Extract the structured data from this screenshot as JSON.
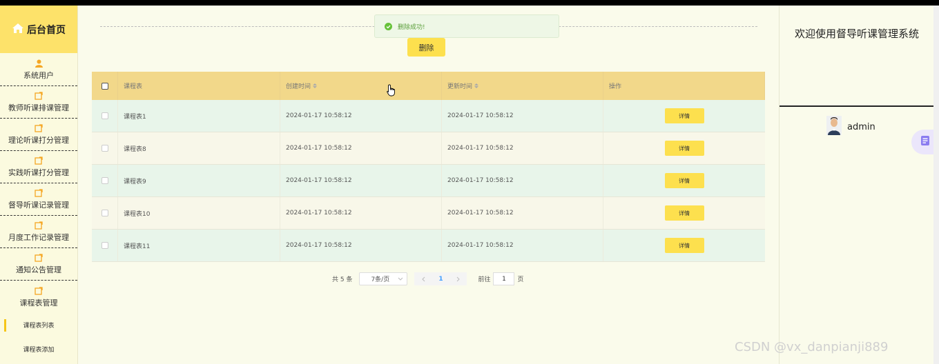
{
  "sidebar": {
    "home_label": "后台首页",
    "items": [
      {
        "label": "系统用户"
      },
      {
        "label": "教师听课排课管理"
      },
      {
        "label": "理论听课打分管理"
      },
      {
        "label": "实践听课打分管理"
      },
      {
        "label": "督导听课记录管理"
      },
      {
        "label": "月度工作记录管理"
      },
      {
        "label": "通知公告管理"
      },
      {
        "label": "课程表管理"
      }
    ],
    "sub_items": [
      {
        "label": "课程表列表"
      },
      {
        "label": "课程表添加"
      }
    ]
  },
  "toast": {
    "message": "删除成功!"
  },
  "toolbar": {
    "delete_label": "删除"
  },
  "table": {
    "headers": {
      "name": "课程表",
      "created": "创建时间",
      "updated": "更新时间",
      "op": "操作"
    },
    "rows": [
      {
        "name": "课程表1",
        "created": "2024-01-17 10:58:12",
        "updated": "2024-01-17 10:58:12",
        "action": "详情"
      },
      {
        "name": "课程表8",
        "created": "2024-01-17 10:58:12",
        "updated": "2024-01-17 10:58:12",
        "action": "详情"
      },
      {
        "name": "课程表9",
        "created": "2024-01-17 10:58:12",
        "updated": "2024-01-17 10:58:12",
        "action": "详情"
      },
      {
        "name": "课程表10",
        "created": "2024-01-17 10:58:12",
        "updated": "2024-01-17 10:58:12",
        "action": "详情"
      },
      {
        "name": "课程表11",
        "created": "2024-01-17 10:58:12",
        "updated": "2024-01-17 10:58:12",
        "action": "详情"
      }
    ]
  },
  "pagination": {
    "total": "共 5 条",
    "page_size": "7条/页",
    "current_page": "1",
    "goto_label": "前往",
    "goto_value": "1",
    "page_suffix": "页"
  },
  "right_panel": {
    "welcome": "欢迎使用督导听课管理系统",
    "username": "admin"
  },
  "watermark": "CSDN @vx_danpianji889",
  "colors": {
    "accent": "#fde04e",
    "header": "#f2d88a",
    "sidebar_home": "#fde26a",
    "row_even": "#e8f5ea",
    "row_odd": "#f8f7e9"
  }
}
